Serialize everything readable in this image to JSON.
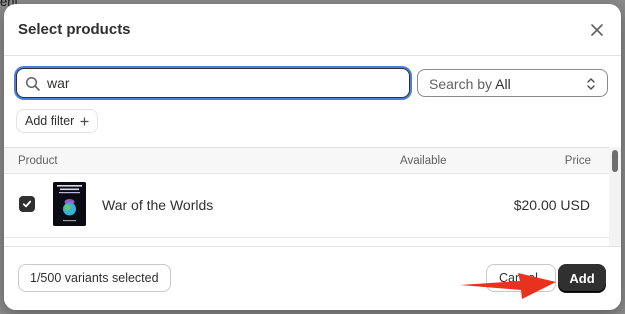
{
  "background": {
    "fragment_text": "ent"
  },
  "modal": {
    "title": "Select products",
    "close_icon": "close-icon"
  },
  "search": {
    "value": "war",
    "placeholder": "",
    "search_by_prefix": "Search by ",
    "search_by_value": "All"
  },
  "filter": {
    "label": "Add filter",
    "icon": "plus-icon"
  },
  "table": {
    "columns": [
      "Product",
      "Available",
      "Price"
    ],
    "rows": [
      {
        "checked": true,
        "name": "War of the Worlds",
        "available": "",
        "price": "$20.00 USD"
      }
    ]
  },
  "footer": {
    "selected_label": "1/500 variants selected",
    "cancel_label": "Cancel",
    "add_label": "Add"
  },
  "colors": {
    "primary_button": "#303030",
    "focus_ring": "#4d7fd6",
    "annotation_arrow": "#e8321f"
  }
}
